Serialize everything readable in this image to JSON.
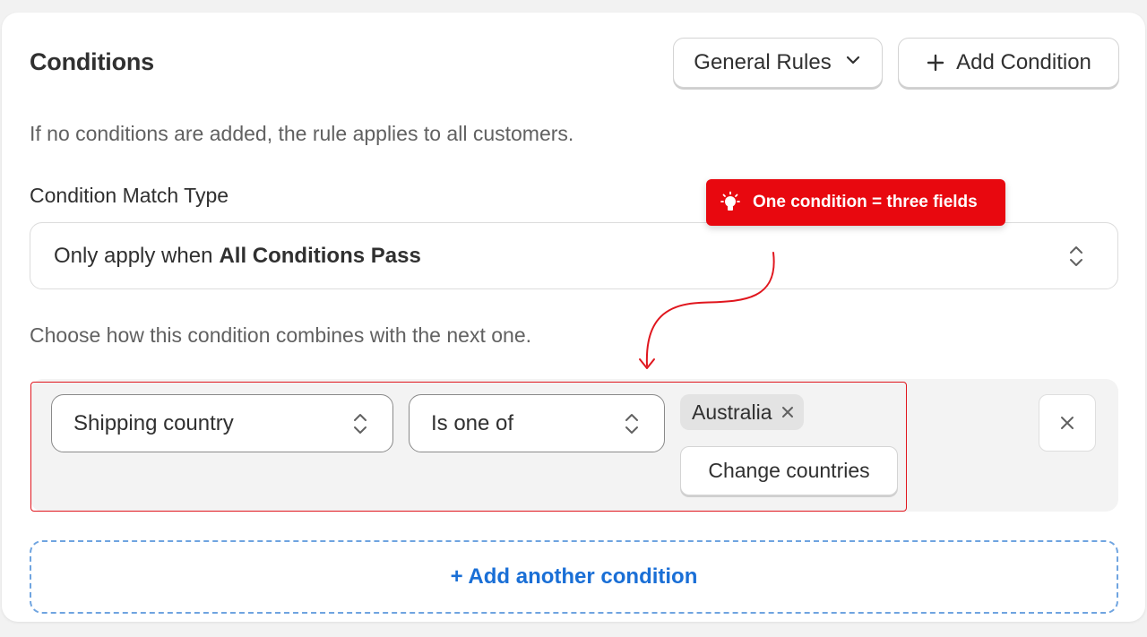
{
  "header": {
    "title": "Conditions",
    "rules_dropdown_label": "General Rules",
    "add_condition_label": "Add Condition"
  },
  "intro_note": "If no conditions are added, the rule applies to all customers.",
  "match_type": {
    "label": "Condition Match Type",
    "prefix": "Only apply when",
    "value": "All Conditions Pass"
  },
  "combine_hint": "Choose how this condition combines with the next one.",
  "condition": {
    "field": "Shipping country",
    "operator": "Is one of",
    "tags": [
      "Australia"
    ],
    "change_label": "Change countries"
  },
  "add_another_label": "+ Add another condition",
  "callout": {
    "text": "One condition = three fields",
    "color": "#e8080f"
  },
  "icons": {
    "dropdown": "chevron-down-icon",
    "add": "plus-icon",
    "select": "up-down-chevron-icon",
    "remove_tag": "x-icon",
    "remove_condition": "close-icon",
    "callout": "lightbulb-icon"
  }
}
